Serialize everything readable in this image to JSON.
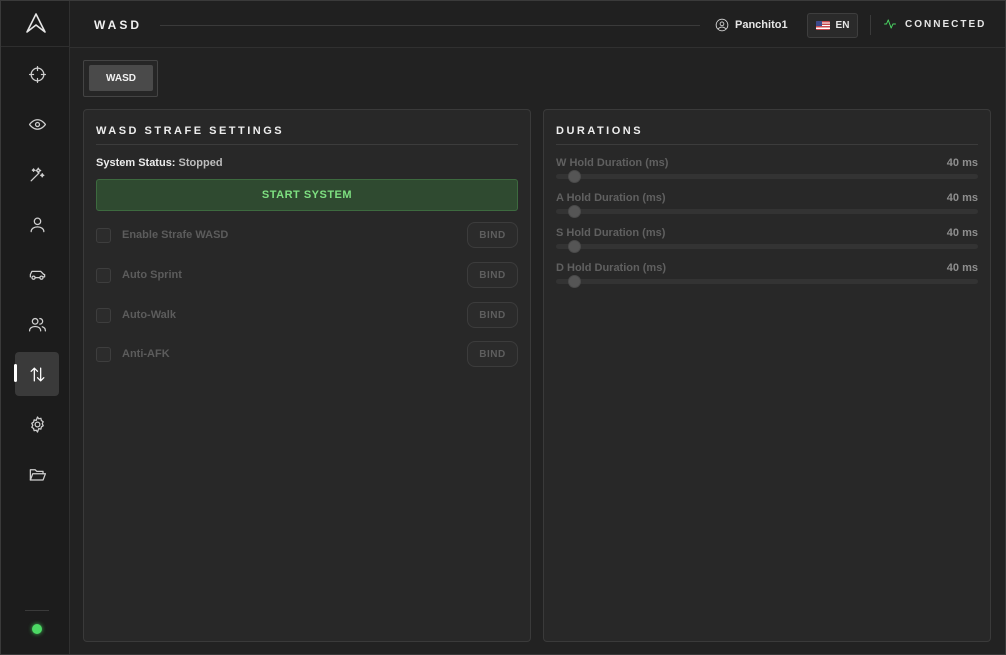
{
  "header": {
    "title": "WASD",
    "user_name": "Panchito1",
    "language": "EN",
    "connection_status": "CONNECTED"
  },
  "sidebar": {
    "items": [
      {
        "name": "crosshair-icon",
        "active": false
      },
      {
        "name": "eye-icon",
        "active": false
      },
      {
        "name": "magic-wand-icon",
        "active": false
      },
      {
        "name": "user-icon",
        "active": false
      },
      {
        "name": "car-icon",
        "active": false
      },
      {
        "name": "users-icon",
        "active": false
      },
      {
        "name": "arrows-up-down-icon",
        "active": true
      },
      {
        "name": "gear-icon",
        "active": false
      },
      {
        "name": "folder-open-icon",
        "active": false
      }
    ]
  },
  "tabs": [
    {
      "label": "WASD",
      "active": true
    }
  ],
  "strafe_panel": {
    "title": "WASD STRAFE SETTINGS",
    "status_label": "System Status:",
    "status_value": "Stopped",
    "start_button": "START SYSTEM",
    "options": [
      {
        "label": "Enable Strafe WASD",
        "checked": false,
        "bind": "BIND"
      },
      {
        "label": "Auto Sprint",
        "checked": false,
        "bind": "BIND"
      },
      {
        "label": "Auto-Walk",
        "checked": false,
        "bind": "BIND"
      },
      {
        "label": "Anti-AFK",
        "checked": false,
        "bind": "BIND"
      }
    ]
  },
  "durations_panel": {
    "title": "DURATIONS",
    "sliders": [
      {
        "label": "W Hold Duration (ms)",
        "value_text": "40 ms",
        "fraction": 0.03
      },
      {
        "label": "A Hold Duration (ms)",
        "value_text": "40 ms",
        "fraction": 0.03
      },
      {
        "label": "S Hold Duration (ms)",
        "value_text": "40 ms",
        "fraction": 0.03
      },
      {
        "label": "D Hold Duration (ms)",
        "value_text": "40 ms",
        "fraction": 0.03
      }
    ]
  },
  "colors": {
    "accent_green": "#4cd964",
    "start_button_text": "#7ee081"
  }
}
